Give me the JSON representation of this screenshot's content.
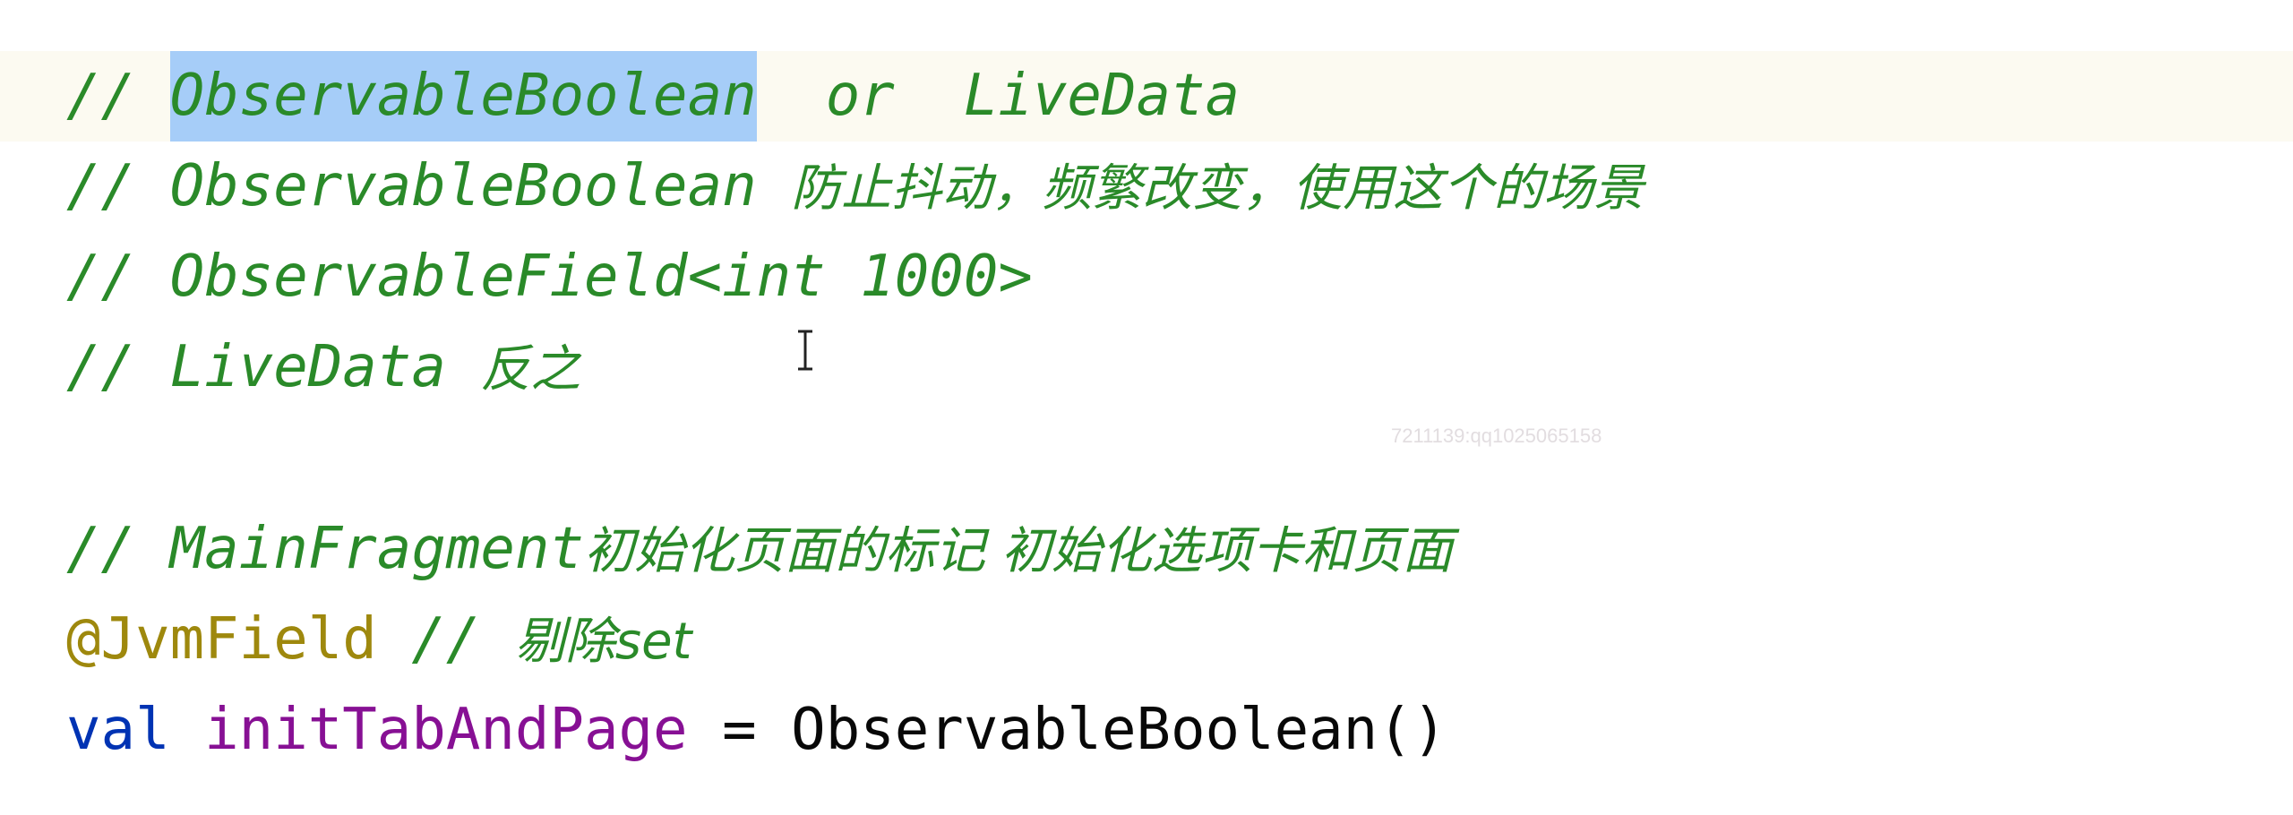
{
  "editor": {
    "lines": [
      {
        "slash": "//",
        "selected": "ObservableBoolean",
        "rest": "  or  LiveData"
      },
      {
        "slash": "//",
        "ident": "ObservableBoolean",
        "note": "防止抖动，频繁改变，使用这个的场景"
      },
      {
        "text": "// ObservableField<int 1000>"
      },
      {
        "slash": "//",
        "ident": "LiveData",
        "note": "反之"
      },
      {
        "slash": "//",
        "ident": "MainFragment",
        "note": "初始化页面的标记 初始化选项卡和页面"
      },
      {
        "annotation": "@JvmField",
        "slash": "//",
        "note": "剔除set"
      },
      {
        "keyword": "val",
        "ident": "initTabAndPage",
        "equals": "=",
        "call": "ObservableBoolean()"
      }
    ]
  },
  "watermark": "7211139:qq1025065158",
  "colors": {
    "comment": "#2a8a29",
    "selection": "#a6cdf8",
    "current_line": "#fcfaf1",
    "annotation": "#9e880d",
    "keyword": "#0033b3",
    "property": "#871094",
    "plain": "#080808"
  },
  "cursor_icon": "text-ibeam-cursor-icon"
}
